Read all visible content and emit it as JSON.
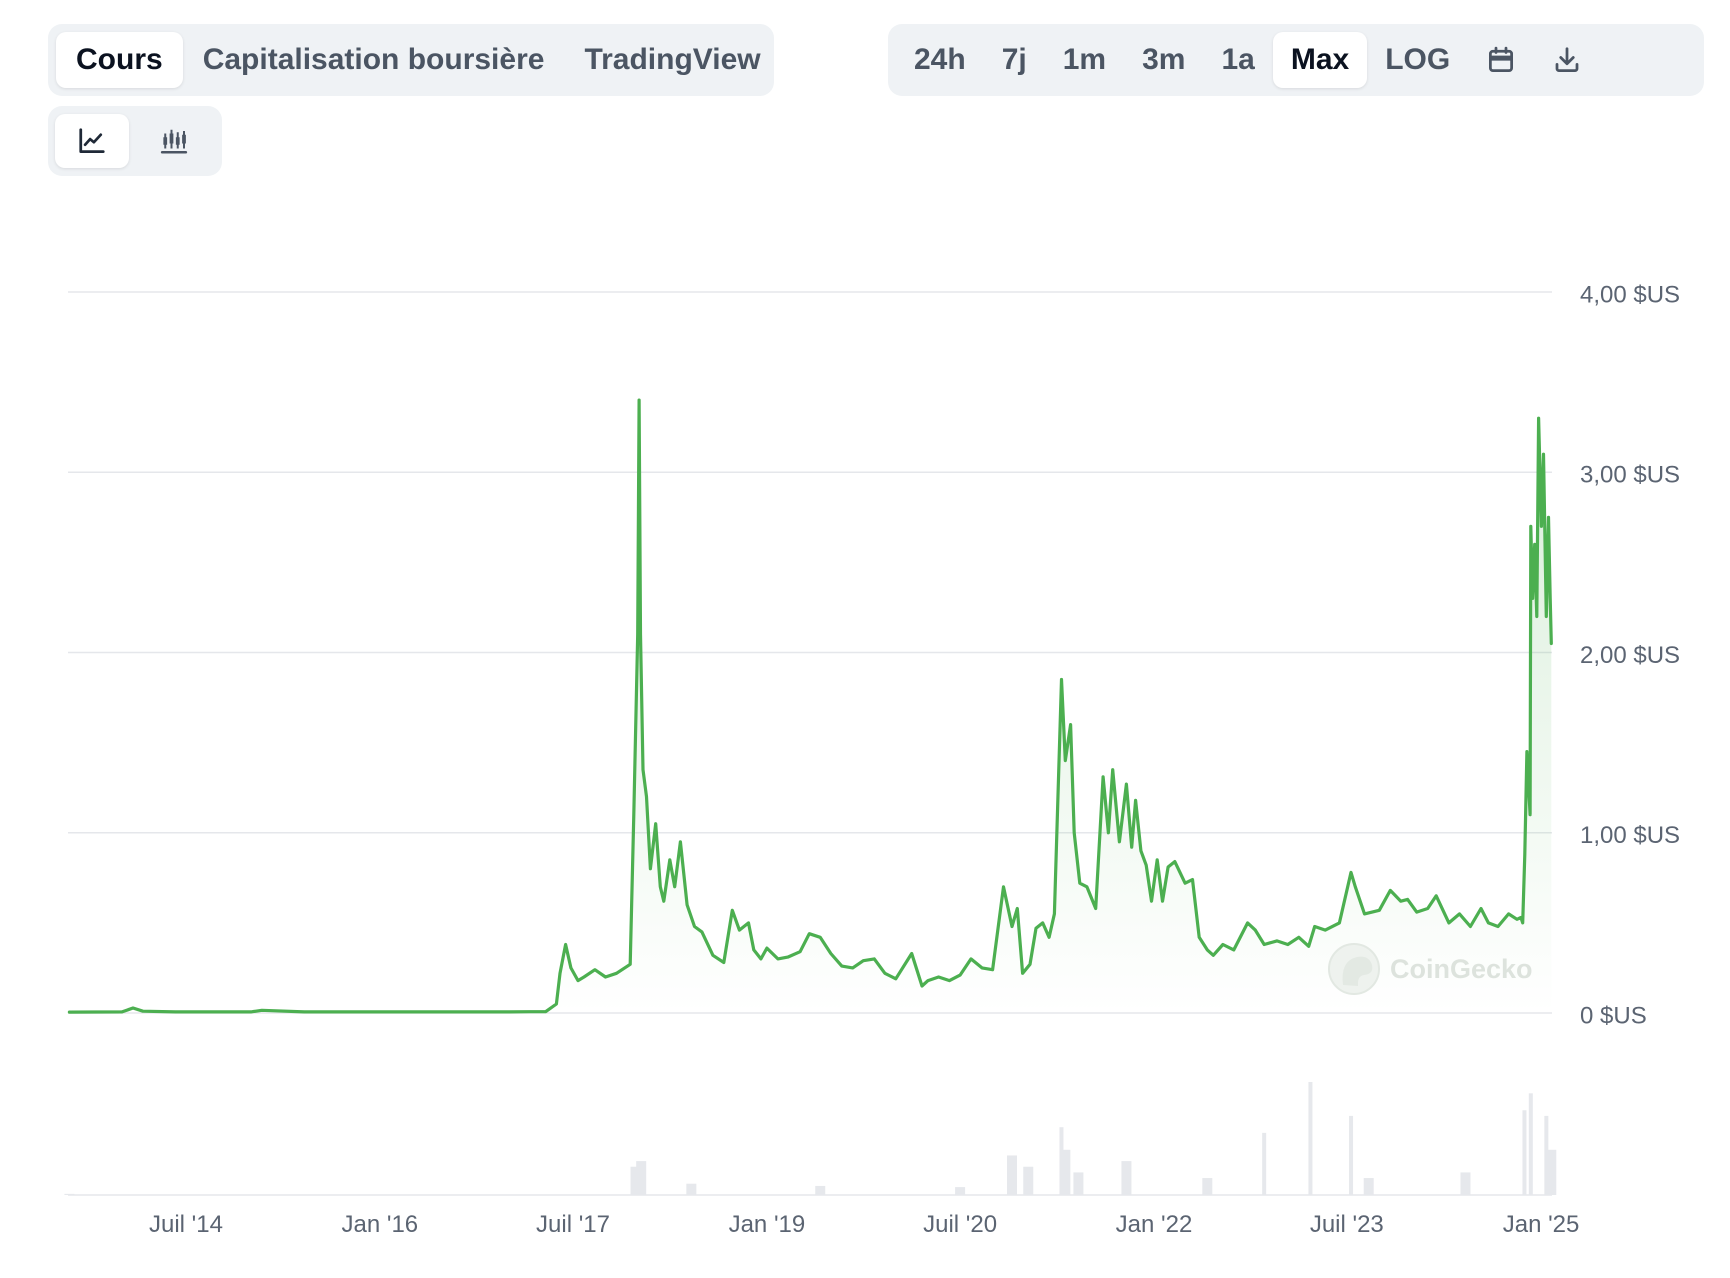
{
  "tabs": {
    "price": "Cours",
    "market_cap": "Capitalisation boursière",
    "tradingview": "TradingView"
  },
  "ranges": {
    "d24h": "24h",
    "d7": "7j",
    "m1": "1m",
    "m3": "3m",
    "y1": "1a",
    "max": "Max",
    "log": "LOG"
  },
  "active_tab": "Cours",
  "active_range": "Max",
  "icons": {
    "calendar": "calendar-icon",
    "download": "download-icon",
    "line_chart": "line-chart-icon",
    "candlestick": "candlestick-icon"
  },
  "watermark": "CoinGecko",
  "colors": {
    "line": "#4caf50",
    "grid": "#e5e7eb",
    "tab_bg": "#eff2f5",
    "volume": "#e6e8ec"
  },
  "chart_data": {
    "type": "line",
    "title": "",
    "xlabel": "",
    "ylabel": "",
    "ylim": [
      0,
      4
    ],
    "y_ticks": [
      {
        "value": 0,
        "label": "0 $US"
      },
      {
        "value": 1,
        "label": "1,00 $US"
      },
      {
        "value": 2,
        "label": "2,00 $US"
      },
      {
        "value": 3,
        "label": "3,00 $US"
      },
      {
        "value": 4,
        "label": "4,00 $US"
      }
    ],
    "xlim": [
      "2013-08-01",
      "2025-02-01"
    ],
    "x_ticks": [
      {
        "date": "2014-07-01",
        "label": "Juil '14"
      },
      {
        "date": "2016-01-01",
        "label": "Jan '16"
      },
      {
        "date": "2017-07-01",
        "label": "Juil '17"
      },
      {
        "date": "2019-01-01",
        "label": "Jan '19"
      },
      {
        "date": "2020-07-01",
        "label": "Juil '20"
      },
      {
        "date": "2022-01-01",
        "label": "Jan '22"
      },
      {
        "date": "2023-07-01",
        "label": "Juil '23"
      },
      {
        "date": "2025-01-01",
        "label": "Jan '25"
      }
    ],
    "grid": true,
    "legend": "none",
    "series": [
      {
        "x": [
          "2013-08-05",
          "2014-01-01",
          "2014-02-01",
          "2014-03-01",
          "2014-06-01",
          "2015-01-01",
          "2015-02-01",
          "2015-06-01",
          "2016-01-01",
          "2016-06-01",
          "2017-01-01",
          "2017-03-01",
          "2017-04-15",
          "2017-05-15",
          "2017-05-25",
          "2017-06-10",
          "2017-06-25",
          "2017-07-15",
          "2017-08-01",
          "2017-09-01",
          "2017-10-01",
          "2017-11-01",
          "2017-12-10",
          "2017-12-20",
          "2017-12-31",
          "2018-01-04",
          "2018-01-08",
          "2018-01-15",
          "2018-01-25",
          "2018-02-05",
          "2018-02-20",
          "2018-03-05",
          "2018-03-15",
          "2018-04-01",
          "2018-04-15",
          "2018-05-01",
          "2018-05-20",
          "2018-06-10",
          "2018-07-01",
          "2018-08-01",
          "2018-09-01",
          "2018-09-25",
          "2018-10-15",
          "2018-11-10",
          "2018-11-25",
          "2018-12-15",
          "2019-01-01",
          "2019-02-01",
          "2019-03-01",
          "2019-04-05",
          "2019-05-01",
          "2019-06-01",
          "2019-07-01",
          "2019-08-01",
          "2019-09-01",
          "2019-10-01",
          "2019-11-01",
          "2019-12-01",
          "2020-01-01",
          "2020-02-15",
          "2020-03-15",
          "2020-04-01",
          "2020-05-01",
          "2020-06-01",
          "2020-07-01",
          "2020-08-01",
          "2020-09-01",
          "2020-10-01",
          "2020-11-01",
          "2020-11-25",
          "2020-12-10",
          "2020-12-25",
          "2021-01-15",
          "2021-02-01",
          "2021-02-20",
          "2021-03-10",
          "2021-03-25",
          "2021-04-14",
          "2021-04-25",
          "2021-05-10",
          "2021-05-20",
          "2021-06-05",
          "2021-06-25",
          "2021-07-20",
          "2021-08-10",
          "2021-08-25",
          "2021-09-06",
          "2021-09-25",
          "2021-10-15",
          "2021-10-30",
          "2021-11-10",
          "2021-11-25",
          "2021-12-10",
          "2021-12-25",
          "2022-01-10",
          "2022-01-25",
          "2022-02-10",
          "2022-03-01",
          "2022-03-30",
          "2022-04-20",
          "2022-05-09",
          "2022-06-01",
          "2022-06-18",
          "2022-07-15",
          "2022-08-15",
          "2022-09-23",
          "2022-10-15",
          "2022-11-09",
          "2022-12-15",
          "2023-01-15",
          "2023-02-15",
          "2023-03-15",
          "2023-04-01",
          "2023-05-01",
          "2023-06-10",
          "2023-07-13",
          "2023-07-25",
          "2023-08-20",
          "2023-10-01",
          "2023-11-01",
          "2023-12-01",
          "2023-12-20",
          "2024-01-15",
          "2024-02-15",
          "2024-03-10",
          "2024-04-15",
          "2024-05-15",
          "2024-06-15",
          "2024-07-15",
          "2024-08-05",
          "2024-09-01",
          "2024-10-01",
          "2024-10-25",
          "2024-11-05",
          "2024-11-10",
          "2024-11-16",
          "2024-11-22",
          "2024-12-01",
          "2024-12-03",
          "2024-12-08",
          "2024-12-14",
          "2024-12-20",
          "2024-12-25",
          "2025-01-02",
          "2025-01-08",
          "2025-01-16",
          "2025-01-22",
          "2025-01-27",
          "2025-01-30"
        ],
        "y": [
          0.005,
          0.006,
          0.028,
          0.01,
          0.006,
          0.006,
          0.015,
          0.006,
          0.006,
          0.006,
          0.006,
          0.007,
          0.008,
          0.05,
          0.22,
          0.38,
          0.25,
          0.18,
          0.2,
          0.24,
          0.2,
          0.22,
          0.27,
          1.1,
          2.1,
          3.4,
          2.1,
          1.35,
          1.2,
          0.8,
          1.05,
          0.7,
          0.62,
          0.85,
          0.7,
          0.95,
          0.6,
          0.48,
          0.45,
          0.32,
          0.28,
          0.57,
          0.46,
          0.5,
          0.35,
          0.3,
          0.36,
          0.3,
          0.31,
          0.34,
          0.44,
          0.42,
          0.33,
          0.26,
          0.25,
          0.29,
          0.3,
          0.22,
          0.19,
          0.33,
          0.15,
          0.18,
          0.2,
          0.18,
          0.21,
          0.3,
          0.25,
          0.24,
          0.7,
          0.48,
          0.58,
          0.22,
          0.27,
          0.47,
          0.5,
          0.42,
          0.55,
          1.85,
          1.4,
          1.6,
          1.0,
          0.72,
          0.7,
          0.58,
          1.31,
          1.0,
          1.35,
          0.95,
          1.27,
          0.92,
          1.18,
          0.9,
          0.82,
          0.62,
          0.85,
          0.62,
          0.81,
          0.84,
          0.72,
          0.74,
          0.42,
          0.35,
          0.32,
          0.38,
          0.35,
          0.5,
          0.46,
          0.38,
          0.4,
          0.38,
          0.42,
          0.37,
          0.48,
          0.46,
          0.5,
          0.78,
          0.7,
          0.55,
          0.57,
          0.68,
          0.62,
          0.63,
          0.56,
          0.58,
          0.65,
          0.5,
          0.55,
          0.48,
          0.58,
          0.5,
          0.48,
          0.55,
          0.52,
          0.53,
          0.5,
          0.88,
          1.45,
          1.1,
          2.7,
          2.3,
          2.6,
          2.2,
          3.3,
          2.7,
          3.1,
          2.2,
          2.75,
          2.3,
          2.05
        ]
      }
    ],
    "volume": {
      "x": [
        "2013-08-05",
        "2017-12-25",
        "2018-01-10",
        "2018-06-01",
        "2019-06-01",
        "2020-07-01",
        "2020-11-25",
        "2021-01-10",
        "2021-04-14",
        "2021-04-25",
        "2021-06-01",
        "2021-10-15",
        "2022-06-01",
        "2022-11-09",
        "2023-03-20",
        "2023-07-13",
        "2023-09-01",
        "2024-06-01",
        "2024-11-15",
        "2024-12-03",
        "2025-01-16",
        "2025-01-30"
      ],
      "values": [
        0.01,
        0.25,
        0.3,
        0.1,
        0.08,
        0.07,
        0.35,
        0.25,
        0.6,
        0.4,
        0.2,
        0.3,
        0.15,
        0.55,
        1.0,
        0.7,
        0.15,
        0.2,
        0.75,
        0.9,
        0.7,
        0.4
      ]
    }
  }
}
